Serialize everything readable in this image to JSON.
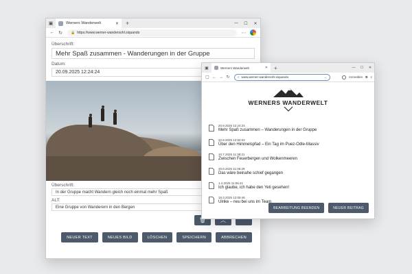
{
  "editor_window": {
    "tab_title": "Werners Wanderwelt",
    "url": "https://www.werner-wandersohl.siquando",
    "heading_label": "Überschrift:",
    "heading_value": "Mehr Spaß zusammen - Wanderungen in der Gruppe",
    "date_label": "Datum:",
    "date_value": "20.09.2025 12:24:24",
    "image_caption_label": "Überschrift:",
    "image_caption_value": "In der Gruppe macht Wandern gleich noch einmal mehr Spaß",
    "alt_label": "ALT:",
    "alt_value": "Eine Gruppe von Wanderern in den Bergen",
    "buttons": {
      "new_text": "NEUER TEXT",
      "new_image": "NEUES BILD",
      "delete": "LÖSCHEN",
      "save": "SPEICHERN",
      "cancel": "ABBRECHEN"
    }
  },
  "preview_window": {
    "tab_title": "Werners Wanderwelt",
    "url": "www.werner-wandersohl.siquando",
    "signin_label": "Anmelden",
    "logo_text": "WERNERS WANDERWELT",
    "posts": [
      {
        "date": "20.9.2025 12:24:24",
        "title": "Mehr Spaß zusammen – Wanderungen in der Gruppe"
      },
      {
        "date": "22.8.2025 12:50:22",
        "title": "Über den Himmelspfad – Ein Tag im Puez-Odle-Massiv"
      },
      {
        "date": "10.7.2025 11:38:21",
        "title": "Zwischen Feuerbergen und Wolkenmeeren"
      },
      {
        "date": "20.6.2025 11:05:29",
        "title": "Das wäre beinahe schief gegangen"
      },
      {
        "date": "1.4.2025 11:06:41",
        "title": "Ich glaube, ich habe den Yeti gesehen!"
      },
      {
        "date": "18.3.2025 12:05:46",
        "title": "Ulrike – neu bei uns im Team"
      }
    ],
    "buttons": {
      "end_editing": "BEARBEITUNG BEENDEN",
      "new_post": "NEUER BEITRAG"
    }
  },
  "colors": {
    "button": "#4c5a6b",
    "page_background": "#e9eaec"
  }
}
